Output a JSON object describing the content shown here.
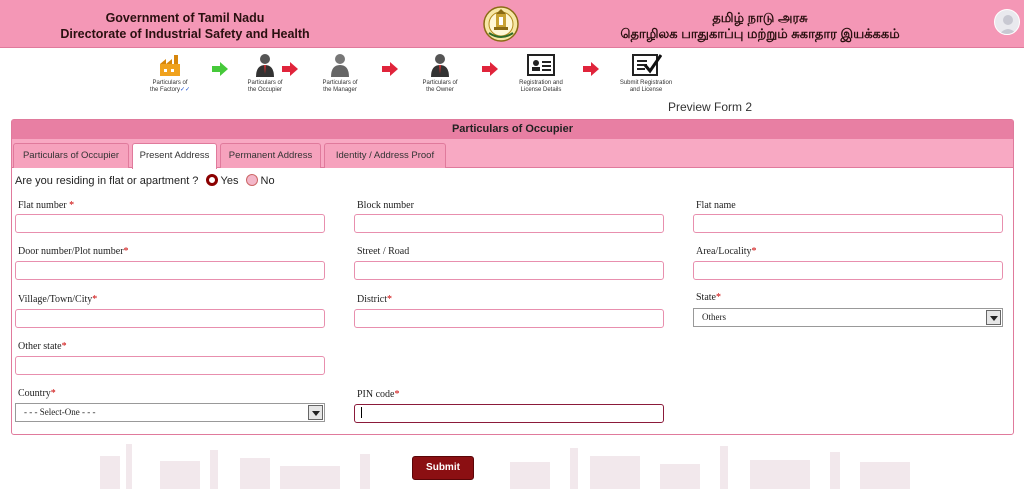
{
  "header": {
    "left_line1": "Government of Tamil Nadu",
    "left_line2": "Directorate of Industrial Safety and Health",
    "right_line1": "தமிழ் நாடு அரசு",
    "right_line2": "தொழிலக பாதுகாப்பு மற்றும் சுகாதார இயக்ககம்",
    "emblem_icon": "tamil-nadu-emblem",
    "avatar_icon": "user-avatar-icon"
  },
  "steps": [
    {
      "line1": "Particulars of",
      "line2": "the Factory",
      "check": "✓✓",
      "icon": "factory-icon"
    },
    {
      "line1": "Particulars of",
      "line2": "the Occupier",
      "icon": "occupier-person-icon"
    },
    {
      "line1": "Particulars of",
      "line2": "the Manager",
      "icon": "manager-person-icon"
    },
    {
      "line1": "Particulars of",
      "line2": "the Owner",
      "icon": "owner-person-icon"
    },
    {
      "line1": "Registration and",
      "line2": "License Details",
      "icon": "id-card-icon"
    },
    {
      "line1": "Submit Registration",
      "line2": "and License",
      "icon": "checklist-icon"
    }
  ],
  "preview_label": "Preview Form 2",
  "panel": {
    "title": "Particulars of Occupier",
    "tabs": [
      "Particulars of Occupier",
      "Present Address",
      "Permanent Address",
      "Identity / Address Proof"
    ],
    "active_tab": "Present Address"
  },
  "question": {
    "text": "Are you residing in flat or apartment ?",
    "yes": "Yes",
    "no": "No",
    "selected": "Yes"
  },
  "fields": {
    "flat_number": {
      "label": "Flat number",
      "required": "*",
      "value": ""
    },
    "block_number": {
      "label": "Block number",
      "value": ""
    },
    "flat_name": {
      "label": "Flat name",
      "value": ""
    },
    "door_number": {
      "label": "Door number/Plot number",
      "required": "*",
      "value": ""
    },
    "street": {
      "label": "Street / Road",
      "value": ""
    },
    "area": {
      "label": "Area/Locality",
      "required": "*",
      "value": ""
    },
    "village": {
      "label": "Village/Town/City",
      "required": "*",
      "value": ""
    },
    "district": {
      "label": "District",
      "required": "*",
      "value": ""
    },
    "state": {
      "label": "State",
      "required": "*",
      "value": "Others"
    },
    "other_state": {
      "label": "Other state",
      "required": "*",
      "value": ""
    },
    "country": {
      "label": "Country",
      "required": "*",
      "value": "- - - Select-One - - -"
    },
    "pin_code": {
      "label": "PIN code",
      "required": "*",
      "value": ""
    }
  },
  "submit_label": "Submit",
  "colors": {
    "header_bg": "#f497b6",
    "panel_title_bg": "#e87fa3",
    "tab_bg": "#f8a9c3",
    "submit_bg": "#8b0f12",
    "required": "#cc0000"
  }
}
